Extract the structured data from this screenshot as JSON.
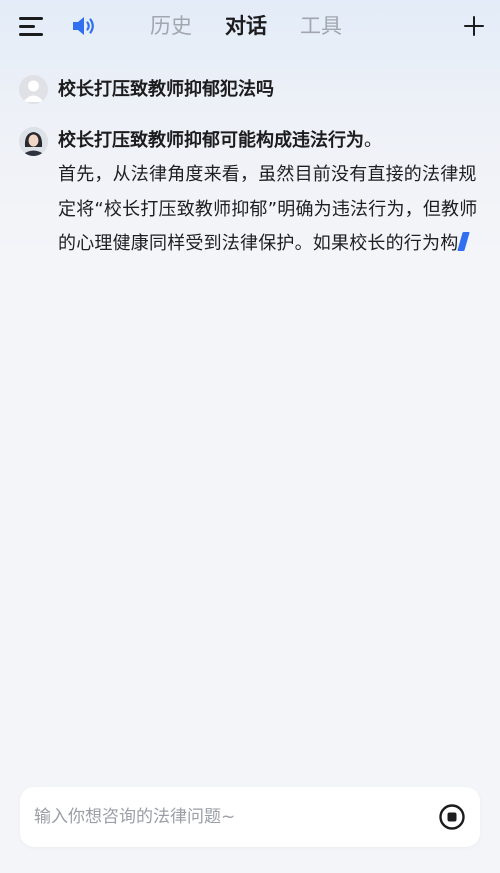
{
  "header": {
    "tabs": [
      {
        "label": "历史"
      },
      {
        "label": "对话"
      },
      {
        "label": "工具"
      }
    ],
    "active_tab": "对话",
    "icons": {
      "menu": "menu-icon",
      "speaker": "speaker-icon",
      "add": "plus-icon"
    },
    "accent_color": "#2f6ff0"
  },
  "conversation": {
    "user_message": "校长打压致教师抑郁犯法吗",
    "bot_message": {
      "lead": "校长打压致教师抑郁可能构成违法行为",
      "lead_punct": "。",
      "body": "首先，从法律角度来看，虽然目前没有直接的法律规定将“校长打压致教师抑郁”明确为违法行为，但教师的心理健康同样受到法律保护。如果校长的行为构"
    }
  },
  "composer": {
    "placeholder": "输入你想咨询的法律问题~",
    "value": "",
    "stop_icon": "stop-circle-icon"
  }
}
